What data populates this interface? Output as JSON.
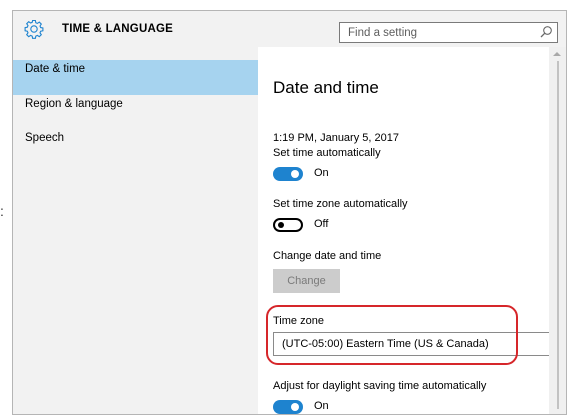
{
  "page_colon": ":",
  "window": {
    "title": "TIME & LANGUAGE",
    "icon": "gear-icon",
    "search": {
      "placeholder": "Find a setting",
      "value": "",
      "icon": "search-icon"
    }
  },
  "sidebar": {
    "items": [
      {
        "label": "Date & time",
        "selected": true
      },
      {
        "label": "Region & language",
        "selected": false
      },
      {
        "label": "Speech",
        "selected": false
      }
    ]
  },
  "main": {
    "title": "Date and time",
    "current_datetime": "1:19 PM, January 5, 2017",
    "set_time_auto": {
      "label": "Set time automatically",
      "state": "On"
    },
    "set_timezone_auto": {
      "label": "Set time zone automatically",
      "state": "Off"
    },
    "change_datetime": {
      "label": "Change date and time",
      "button": "Change"
    },
    "time_zone": {
      "label": "Time zone",
      "value": "(UTC-05:00) Eastern Time (US & Canada)"
    },
    "daylight_saving": {
      "label": "Adjust for daylight saving time automatically",
      "state": "On"
    }
  },
  "colors": {
    "accent": "#1e83cf",
    "selected_nav": "#a6d3ef",
    "highlight": "#d6262a",
    "sidebar_bg": "#f2f2f2"
  }
}
